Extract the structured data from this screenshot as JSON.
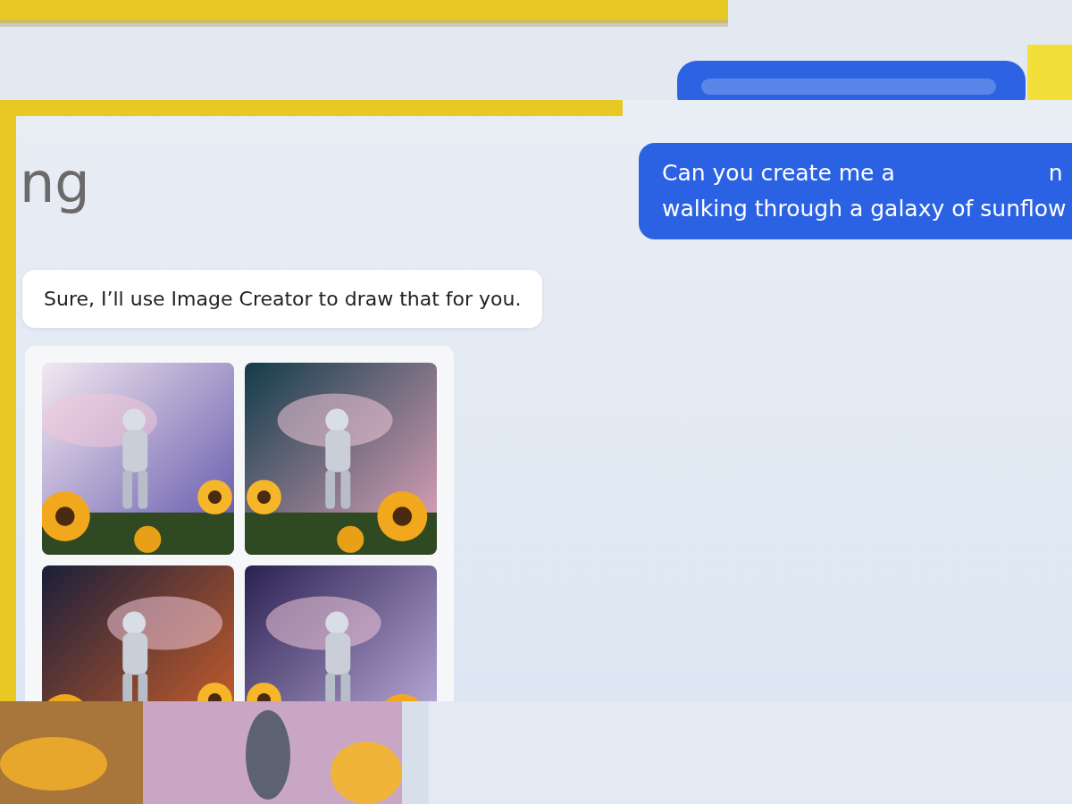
{
  "heading": "ng",
  "bot_message": {
    "text": "Sure, I’ll use Image Creator to draw that for you."
  },
  "user_message": {
    "lines": [
      [
        "Can you create me a",
        "n"
      ],
      [
        "walking through a galaxy of sunflow"
      ]
    ]
  }
}
